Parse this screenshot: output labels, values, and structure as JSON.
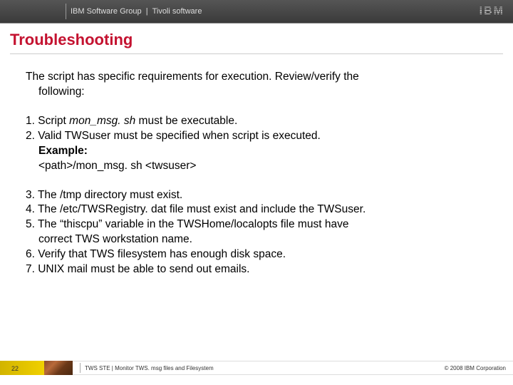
{
  "header": {
    "group": "IBM Software Group",
    "separator": "|",
    "product": "Tivoli software",
    "logo_text": "IBM"
  },
  "title": "Troubleshooting",
  "intro_line1": "The script has specific requirements for execution. Review/verify the",
  "intro_line2": "following:",
  "block1": {
    "l1a": "1. Script ",
    "l1b": "mon_msg. sh ",
    "l1c": "must be executable.",
    "l2": "2. Valid TWSuser must be specified when script is executed.",
    "l3": "Example:",
    "l4": "<path>/mon_msg. sh <twsuser>"
  },
  "block2": {
    "l1": "3. The /tmp directory must exist.",
    "l2": "4. The /etc/TWSRegistry. dat file must exist and include the TWSuser.",
    "l3a": "5. The “thiscpu” variable in the TWSHome/localopts file must have",
    "l3b": "correct TWS workstation name.",
    "l4": "6. Verify that TWS filesystem has enough disk space.",
    "l5": "7. UNIX mail must be able to send out emails."
  },
  "footer": {
    "page": "22",
    "left": "TWS STE | Monitor TWS. msg files and Filesystem",
    "right": "© 2008 IBM Corporation"
  }
}
